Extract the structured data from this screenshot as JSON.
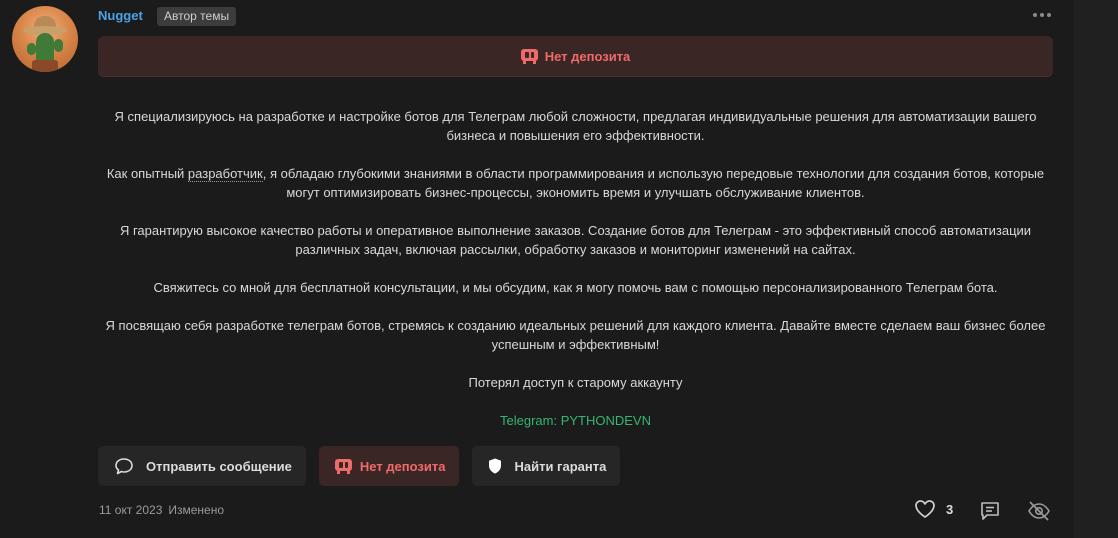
{
  "post": {
    "author": "Nugget",
    "author_badge": "Автор темы",
    "deposit_banner": "Нет депозита",
    "paragraphs": [
      {
        "before": "Я специализируюсь на разработке и настройке ботов для Телеграм любой сложности, предлагая индивидуальные решения для автоматизации вашего бизнеса и повышения его эффективности."
      },
      {
        "before": "Как опытный ",
        "link": "разработчик",
        "after": ", я обладаю глубокими знаниями в области программирования и использую передовые технологии для создания ботов, которые могут оптимизировать бизнес-процессы, экономить время и улучшать обслуживание клиентов."
      },
      {
        "before": "Я гарантирую высокое качество работы и оперативное выполнение заказов. Создание ботов для Телеграм - это эффективный способ автоматизации различных задач, включая рассылки, обработку заказов и мониторинг изменений на сайтах."
      },
      {
        "before": "Свяжитесь со мной для бесплатной консультации, и мы обсудим, как я могу помочь вам с помощью персонализированного Телеграм бота."
      },
      {
        "before": "Я посвящаю себя разработке телеграм ботов, стремясь к созданию идеальных решений для каждого клиента. Давайте вместе сделаем ваш бизнес более успешным и эффективным!"
      },
      {
        "before": "Потерял доступ к старому аккаунту"
      }
    ],
    "telegram": "Telegram: PYTHONDEVN",
    "actions": {
      "message": "Отправить сообщение",
      "deposit": "Нет депозита",
      "guarantor": "Найти гаранта"
    },
    "date": "11 окт 2023",
    "edited": "Изменено",
    "likes": "3"
  },
  "colors": {
    "author": "#4aa3e8",
    "danger": "#ef6a6a",
    "telegram": "#37b574"
  },
  "icons": [
    "more-icon",
    "deposit-icon",
    "chat-icon",
    "shield-icon",
    "heart-icon",
    "reply-icon",
    "hide-icon"
  ]
}
